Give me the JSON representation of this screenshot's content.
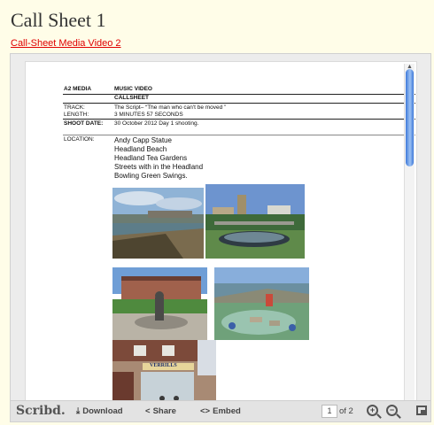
{
  "page": {
    "title": "Call Sheet 1",
    "link": "Call-Sheet Media Video 2"
  },
  "callsheet": {
    "company": "A2 MEDIA",
    "kind": "MUSIC VIDEO",
    "doc_label": "CALLSHEET",
    "track_label": "TRACK:",
    "track_value": "The Script– “The man who can't be moved ”",
    "length_label": "LENGTH:",
    "length_value": "3 MINUTES 57 SECONDS",
    "shoot_label": "SHOOT DATE:",
    "shoot_value": "30 October 2012 Day 1 shooting.",
    "location_label": "LOCATION:",
    "locations": [
      "Andy Capp Statue",
      "Headland Beach",
      "Headland Tea Gardens",
      "Streets with in the Headland",
      "Bowling Green Swings."
    ],
    "shop_sign": "VERRILLS"
  },
  "toolbar": {
    "logo": "Scribd.",
    "download": "Download",
    "share": "Share",
    "embed": "Embed",
    "page_current": "1",
    "page_of": "of 2"
  },
  "icons": {
    "download": "download-icon",
    "share": "share-icon",
    "embed": "embed-icon",
    "zoom_in": "zoom-in-icon",
    "zoom_out": "zoom-out-icon",
    "fullscreen": "fullscreen-icon"
  },
  "colors": {
    "background": "#fffde8",
    "link": "#e00000",
    "scroll_thumb": "#3f79d9"
  }
}
